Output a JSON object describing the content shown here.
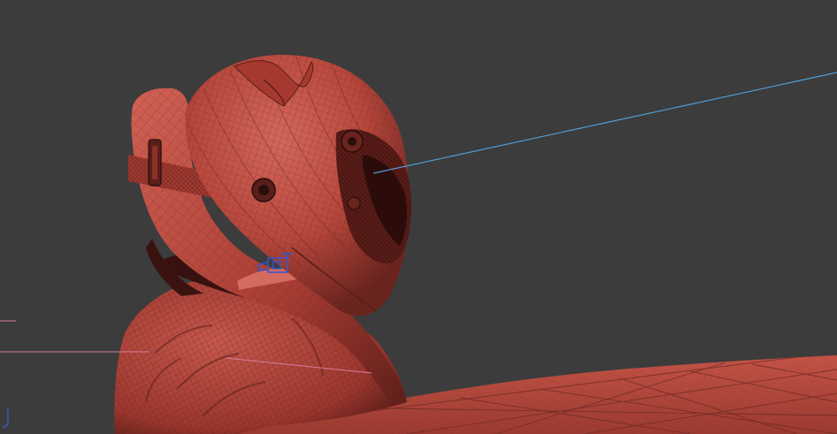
{
  "viewport": {
    "view": "perspective",
    "background_color": "#3c3c3c",
    "mesh_color": "#b8473c",
    "mesh_shadow_color": "#5a1f1a",
    "wire_color": "#6e2a24",
    "light_line_color": "#4f9ed8",
    "helper_line_color": "#d67ea3",
    "gizmo_color": "#2f56d9",
    "axis_tripod_color": "#3c62d6"
  },
  "scene": {
    "objects": [
      {
        "name": "helmet",
        "icon": "helmet-mesh"
      },
      {
        "name": "neck-brace",
        "icon": "brace-mesh"
      },
      {
        "name": "jacket",
        "icon": "cloth-mesh"
      },
      {
        "name": "ground-plane",
        "icon": "plane-mesh"
      },
      {
        "name": "light-target-line",
        "icon": "light-icon"
      },
      {
        "name": "camera-gizmo",
        "icon": "camera-icon"
      }
    ]
  }
}
